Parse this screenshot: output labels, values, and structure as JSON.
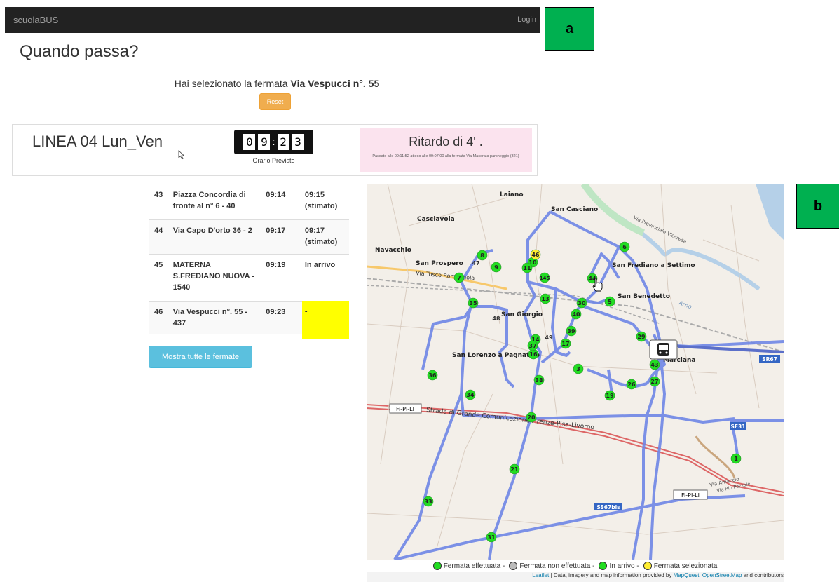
{
  "navbar": {
    "brand": "scuolaBUS",
    "login": "Login"
  },
  "panel_labels": {
    "a": "a",
    "b": "b"
  },
  "page_title": "Quando passa?",
  "selection": {
    "prefix": "Hai selezionato la fermata ",
    "stop": "Via Vespucci n°. 55",
    "reset_label": "Reset"
  },
  "line": {
    "name": "LINEA 04 Lun_Ven",
    "clock_digits": [
      "0",
      "9",
      "2",
      "3"
    ],
    "clock_caption": "Orario Previsto",
    "delay_title": "Ritardo di 4' .",
    "delay_note": "Passato alle 09:11:52 atteso alle 09:07:00 alla fermata Via Macerata parcheggio (321)"
  },
  "stops_table": [
    {
      "num": "43",
      "name": "Piazza Concordia di fronte al n° 6 - 40",
      "time": "09:14",
      "state": "09:15 (stimato)"
    },
    {
      "num": "44",
      "name": "Via Capo D'orto 36 - 2",
      "time": "09:17",
      "state": "09:17 (stimato)"
    },
    {
      "num": "45",
      "name": "MATERNA S.FREDIANO NUOVA - 1540",
      "time": "09:19",
      "state": "In arrivo"
    },
    {
      "num": "46",
      "name": "Via Vespucci n°. 55 - 437",
      "time": "09:23",
      "state": "-"
    }
  ],
  "show_all_label": "Mostra tutte le fermate",
  "map": {
    "place_labels": [
      "Laiano",
      "San Casciano",
      "Casciavola",
      "Navacchio",
      "San Prospero",
      "San Frediano a Settimo",
      "San Benedetto",
      "San Giorgio",
      "San Lorenzo a Pagnatico",
      "Marciana",
      "Fi-PI-LI",
      "Strada di Grande Comunicazione Firenze-Pisa-Livorno",
      "Via Tosco Romagnola",
      "Arno",
      "Via Provinciale Vicarese",
      "Via Amaccio",
      "Via Rio Pozzale",
      "SS67bis",
      "SF31",
      "SR67"
    ],
    "stops": [
      {
        "n": "1",
        "s": "done"
      },
      {
        "n": "3",
        "s": "done"
      },
      {
        "n": "5",
        "s": "done"
      },
      {
        "n": "6",
        "s": "done"
      },
      {
        "n": "7",
        "s": "done"
      },
      {
        "n": "8",
        "s": "done"
      },
      {
        "n": "9",
        "s": "done"
      },
      {
        "n": "10",
        "s": "done"
      },
      {
        "n": "11",
        "s": "done"
      },
      {
        "n": "13",
        "s": "done"
      },
      {
        "n": "14",
        "s": "done"
      },
      {
        "n": "16",
        "s": "done"
      },
      {
        "n": "17",
        "s": "done"
      },
      {
        "n": "19",
        "s": "done"
      },
      {
        "n": "20",
        "s": "done"
      },
      {
        "n": "21",
        "s": "done"
      },
      {
        "n": "26",
        "s": "done"
      },
      {
        "n": "27",
        "s": "done"
      },
      {
        "n": "29",
        "s": "done"
      },
      {
        "n": "30",
        "s": "done"
      },
      {
        "n": "31",
        "s": "done"
      },
      {
        "n": "33",
        "s": "done"
      },
      {
        "n": "34",
        "s": "done"
      },
      {
        "n": "35",
        "s": "done"
      },
      {
        "n": "36",
        "s": "done"
      },
      {
        "n": "37",
        "s": "done"
      },
      {
        "n": "38",
        "s": "done"
      },
      {
        "n": "39",
        "s": "done"
      },
      {
        "n": "40",
        "s": "done"
      },
      {
        "n": "43",
        "s": "done"
      },
      {
        "n": "145",
        "s": "done"
      },
      {
        "n": "44",
        "s": "arriving"
      },
      {
        "n": "46",
        "s": "selected"
      },
      {
        "n": "47",
        "s": "missed"
      },
      {
        "n": "48",
        "s": "missed"
      },
      {
        "n": "49",
        "s": "missed"
      }
    ]
  },
  "legend": {
    "done": "Fermata effettuata -",
    "missed": "Fermata non effettuata -",
    "arriving": "In arrivo -",
    "selected": "Fermata selezionata"
  },
  "attribution": {
    "leaflet": "Leaflet",
    "text": " | Data, imagery and map information provided by ",
    "mq": "MapQuest",
    "sep": ", ",
    "osm": "OpenStreetMap",
    "tail": " and contributors"
  },
  "colors": {
    "done": "#22dd22",
    "missed": "#bbbbbb",
    "arriving": "#22dd22",
    "selected": "#ffee33",
    "route": "#6f86e6",
    "panel_label": "#00b050"
  }
}
